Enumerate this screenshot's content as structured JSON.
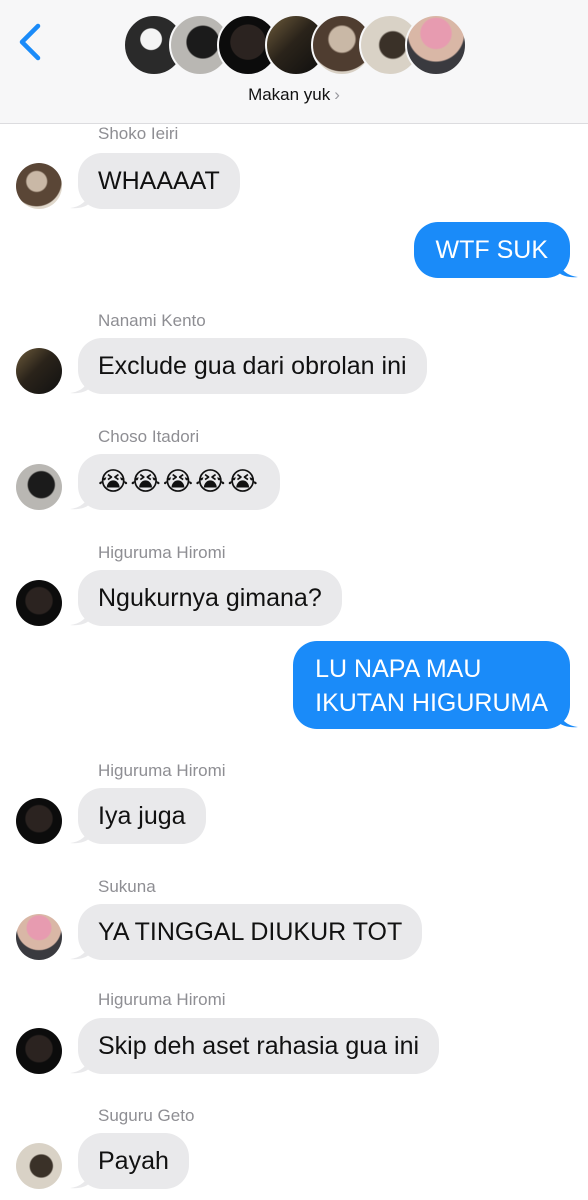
{
  "header": {
    "group_name": "Makan yuk",
    "chevron": "›",
    "back_icon": "chevron-left-icon",
    "members_count": 7
  },
  "colors": {
    "incoming_bubble": "#e9e9eb",
    "outgoing_bubble": "#1a8bf9",
    "accent": "#1a8bf9",
    "sender_text": "#8e8e93"
  },
  "messages": [
    {
      "sender": "Shoko Ieiri",
      "text": "WHAAAAT"
    },
    {
      "sender": "",
      "text": "WTF SUK"
    },
    {
      "sender": "Nanami Kento",
      "text": "Exclude gua dari obrolan ini"
    },
    {
      "sender": "Choso Itadori",
      "text": "😭😭😭😭😭"
    },
    {
      "sender": "Higuruma Hiromi",
      "text": "Ngukurnya gimana?"
    },
    {
      "sender": "",
      "line1": "LU NAPA MAU",
      "line2": "IKUTAN HIGURUMA"
    },
    {
      "sender": "Higuruma Hiromi",
      "text": "Iya juga"
    },
    {
      "sender": "Sukuna",
      "text": "YA TINGGAL DIUKUR TOT"
    },
    {
      "sender": "Higuruma Hiromi",
      "text": "Skip deh aset rahasia gua ini"
    },
    {
      "sender": "Suguru Geto",
      "text": "Payah"
    }
  ]
}
